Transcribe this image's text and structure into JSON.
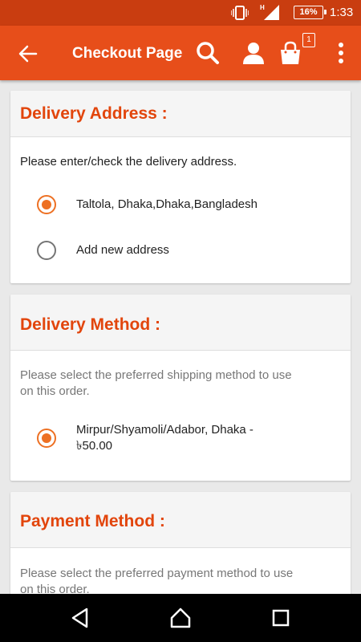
{
  "status_bar": {
    "battery": "16%",
    "time": "1:33",
    "network_type": "H"
  },
  "app_bar": {
    "title": "Checkout Page",
    "cart_count": "1"
  },
  "delivery_address": {
    "title": "Delivery Address :",
    "hint": "Please enter/check the delivery address.",
    "options": [
      {
        "label": "Taltola, Dhaka,Dhaka,Bangladesh",
        "selected": true
      },
      {
        "label": "Add new address",
        "selected": false
      }
    ]
  },
  "delivery_method": {
    "title": "Delivery Method :",
    "hint_line1": "Please select the preferred shipping method to use",
    "hint_line2": "on this order.",
    "options": [
      {
        "label_line1": "Mirpur/Shyamoli/Adabor, Dhaka -",
        "label_line2": "৳50.00",
        "selected": true
      }
    ]
  },
  "payment_method": {
    "title": "Payment Method :",
    "hint_line1": "Please select the preferred payment method to use",
    "hint_line2": "on this order."
  },
  "colors": {
    "status_bar": "#c93d10",
    "app_bar": "#e74e1a",
    "accent": "#e2450c",
    "radio": "#ed7023"
  }
}
